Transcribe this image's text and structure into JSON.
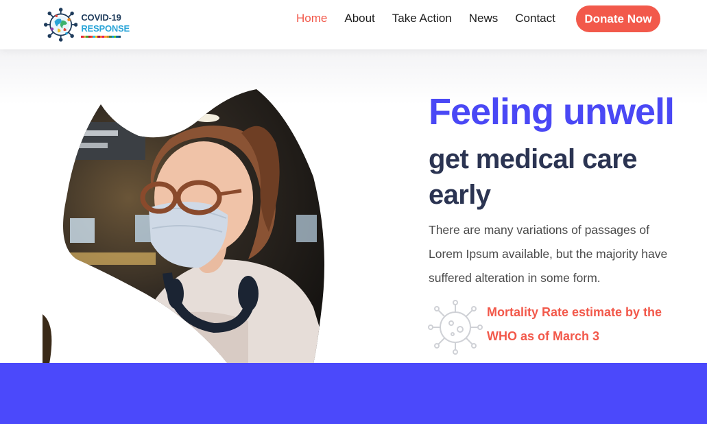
{
  "brand": {
    "line1": "COVID-19",
    "line2": "RESPONSE",
    "colors": {
      "navy": "#1f3c5c",
      "cyan": "#2aa5d8"
    }
  },
  "nav": {
    "items": [
      {
        "label": "Home",
        "active": true
      },
      {
        "label": "About",
        "active": false
      },
      {
        "label": "Take Action",
        "active": false
      },
      {
        "label": "News",
        "active": false
      },
      {
        "label": "Contact",
        "active": false
      }
    ],
    "donate_label": "Donate Now"
  },
  "hero": {
    "headline": "Feeling unwell",
    "subheadline": "get medical care early",
    "paragraph": "There are many variations of passages of Lorem Ipsum available, but the majority have suffered alteration in some form.",
    "stat_text": "Mortality Rate estimate by the WHO as of March 3",
    "image_alt": "Woman wearing a face mask and glasses with headphones around her neck"
  },
  "icons": {
    "logo": "globe-virus-logo-icon",
    "stat": "virus-icon"
  },
  "colors": {
    "accent": "#f2594b",
    "primary": "#4a48f5",
    "heading": "#2b3452",
    "band": "#4b49fb"
  }
}
